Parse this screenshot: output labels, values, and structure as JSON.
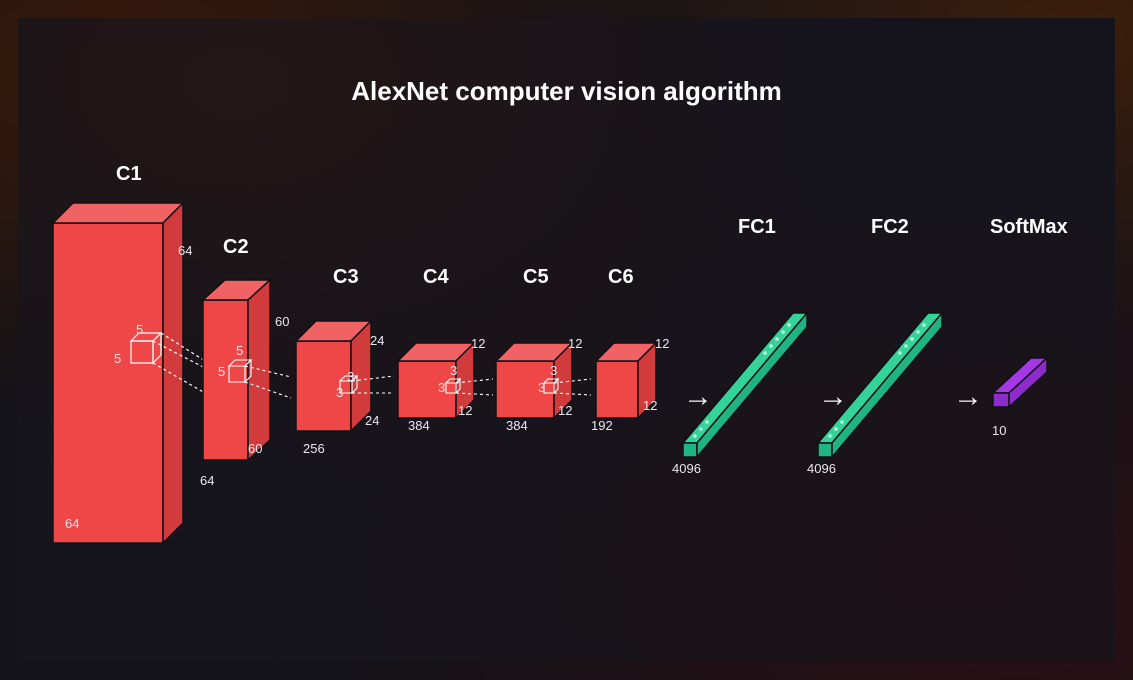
{
  "title": "AlexNet computer vision algorithm",
  "layers": {
    "c1": {
      "label": "C1",
      "h": "64",
      "w": "64",
      "kh": "5",
      "kw": "5"
    },
    "c2": {
      "label": "C2",
      "h": "64",
      "w": "64",
      "d": "60",
      "d2": "60",
      "kh": "5",
      "kw": "5"
    },
    "c3": {
      "label": "C3",
      "h": "24",
      "w": "24",
      "d": "256",
      "kh": "3",
      "kw": "3"
    },
    "c4": {
      "label": "C4",
      "h": "12",
      "w": "12",
      "d": "384",
      "kh": "3",
      "kw": "3"
    },
    "c5": {
      "label": "C5",
      "h": "12",
      "w": "12",
      "d": "384",
      "kh": "3",
      "kw": "3"
    },
    "c6": {
      "label": "C6",
      "h": "12",
      "w": "12",
      "d": "192"
    },
    "fc1": {
      "label": "FC1",
      "n": "4096"
    },
    "fc2": {
      "label": "FC2",
      "n": "4096"
    },
    "softmax": {
      "label": "SoftMax",
      "n": "10"
    }
  },
  "colors": {
    "red_face": "#ef4647",
    "red_top": "#f06263",
    "red_side": "#d13b3c",
    "green_face": "#34d399",
    "green_top": "#5ee4b2",
    "green_side": "#20b482",
    "purple_face": "#a637e6",
    "purple_top": "#bb5cf1",
    "purple_side": "#8e2ccb",
    "stroke": "#101015"
  }
}
